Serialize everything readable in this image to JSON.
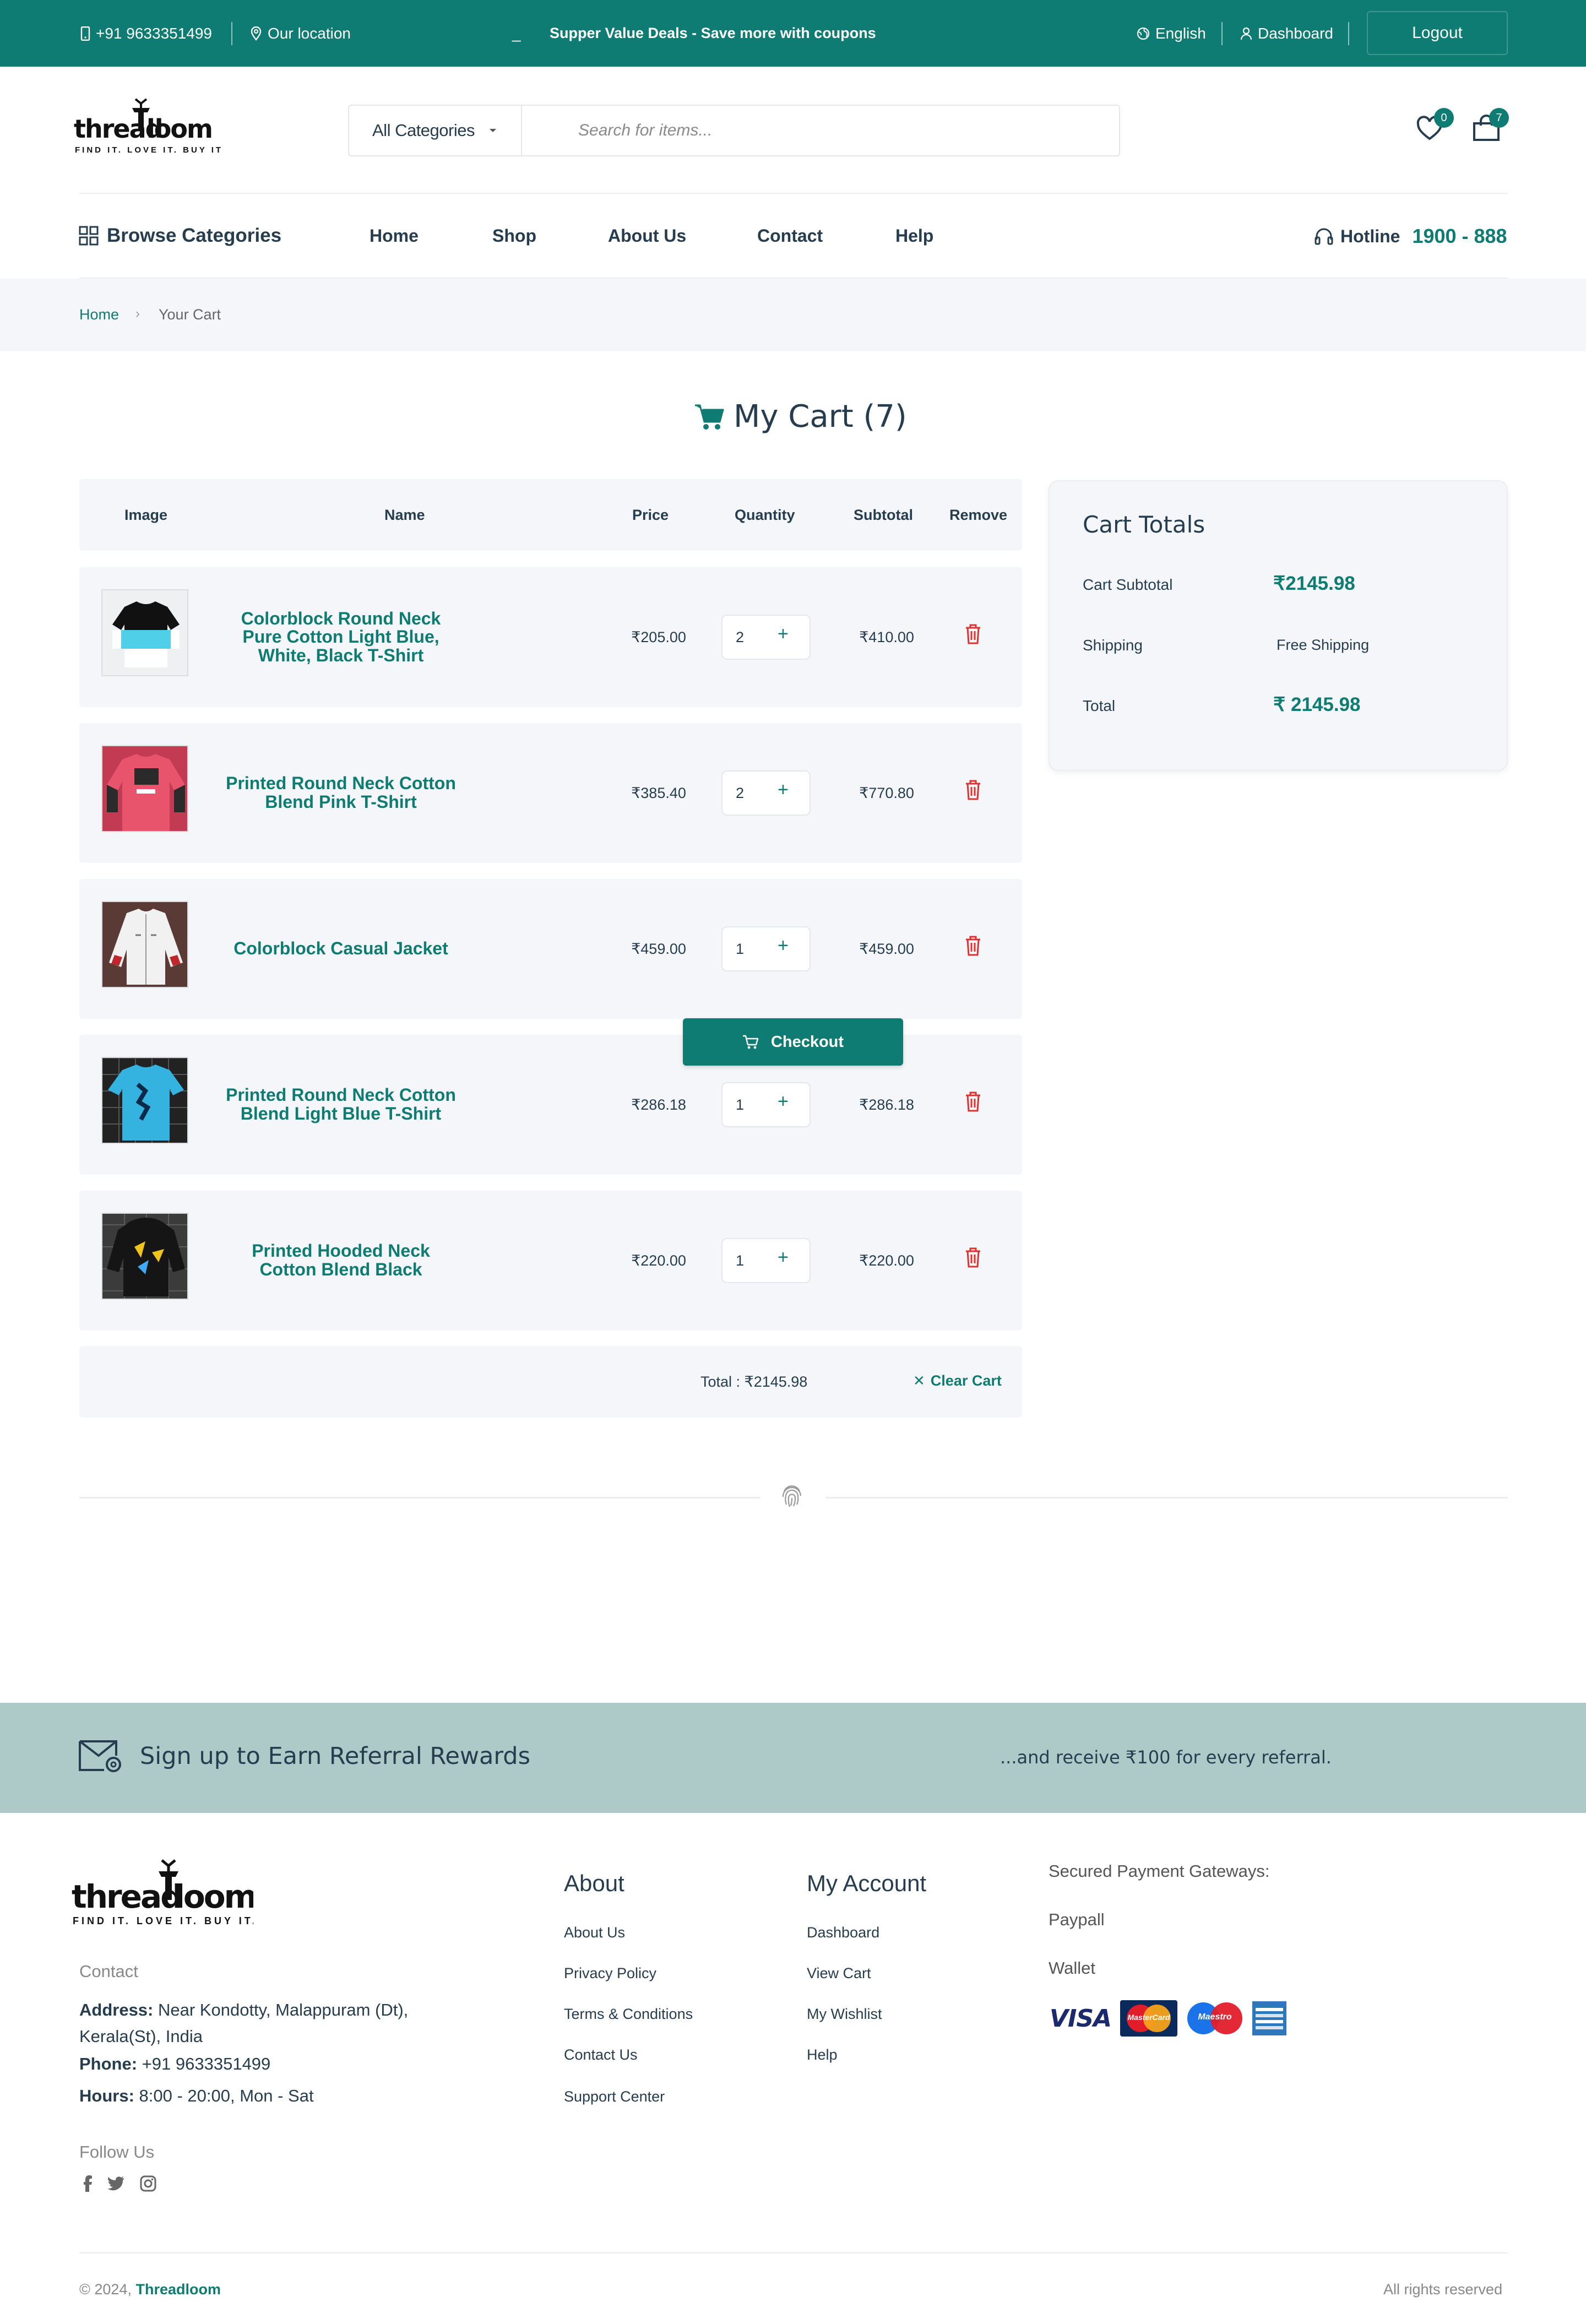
{
  "topbar": {
    "phone": "+91 9633351499",
    "location": "Our location",
    "dash": "_",
    "promo": "Supper Value Deals - Save more with coupons",
    "language": "English",
    "dashboard": "Dashboard",
    "logout": "Logout"
  },
  "brand": {
    "name": "threadloom",
    "tagline": "FIND IT. LOVE IT. BUY IT."
  },
  "search": {
    "category": "All Categories",
    "placeholder": "Search for items..."
  },
  "header": {
    "wishlist_count": "0",
    "cart_count": "7"
  },
  "nav": {
    "browse": "Browse Categories",
    "items": [
      "Home",
      "Shop",
      "About Us",
      "Contact",
      "Help"
    ],
    "hotline_label": "Hotline",
    "hotline_number": "1900 - 888"
  },
  "breadcrumb": {
    "home": "Home",
    "current": "Your Cart"
  },
  "cart": {
    "title": "My Cart (7)",
    "columns": [
      "Image",
      "Name",
      "Price",
      "Quantity",
      "Subtotal",
      "Remove"
    ],
    "items": [
      {
        "name": "Colorblock Round Neck Pure Cotton Light Blue, White, Black T-Shirt",
        "price": "₹205.00",
        "qty": "2",
        "subtotal": "₹410.00",
        "image": "colorblock-tshirt"
      },
      {
        "name": "Printed Round Neck Cotton Blend Pink T-Shirt",
        "price": "₹385.40",
        "qty": "2",
        "subtotal": "₹770.80",
        "image": "pink-tshirt"
      },
      {
        "name": "Colorblock Casual Jacket",
        "price": "₹459.00",
        "qty": "1",
        "subtotal": "₹459.00",
        "image": "jacket"
      },
      {
        "name": "Printed Round Neck Cotton Blend Light Blue T-Shirt",
        "price": "₹286.18",
        "qty": "1",
        "subtotal": "₹286.18",
        "image": "blue-tshirt"
      },
      {
        "name": "Printed Hooded Neck Cotton Blend Black",
        "price": "₹220.00",
        "qty": "1",
        "subtotal": "₹220.00",
        "image": "black-hoodie"
      }
    ],
    "total": "Total : ₹2145.98",
    "clear": "Clear Cart",
    "checkout": "Checkout"
  },
  "totals": {
    "title": "Cart Totals",
    "subtotal_label": "Cart Subtotal",
    "subtotal": "₹2145.98",
    "shipping_label": "Shipping",
    "shipping": "Free Shipping",
    "total_label": "Total",
    "total": "₹ 2145.98"
  },
  "newsletter": {
    "title": "Sign up to Earn Referral Rewards",
    "subtitle": "...and receive ₹100 for every referral."
  },
  "footer": {
    "contact_heading": "Contact",
    "address_label": "Address:",
    "address": "Near Kondotty, Malappuram (Dt), Kerala(St), India",
    "phone_label": "Phone:",
    "phone": "+91 9633351499",
    "hours_label": "Hours:",
    "hours": "8:00 - 20:00, Mon - Sat",
    "follow": "Follow Us",
    "about_heading": "About",
    "about_links": [
      "About Us",
      "Privacy Policy",
      "Terms & Conditions",
      "Contact Us",
      "Support Center"
    ],
    "account_heading": "My Account",
    "account_links": [
      "Dashboard",
      "View Cart",
      "My Wishlist",
      "Help"
    ],
    "payment_heading": "Secured Payment Gateways:",
    "payment_1": "Paypall",
    "payment_2": "Wallet",
    "cards": {
      "visa": "VISA",
      "mastercard": "MasterCard",
      "maestro": "Maestro"
    },
    "copyright": "© 2024,",
    "copyright_brand": "Threadloom",
    "rights": "All rights reserved"
  },
  "colors": {
    "accent": "#0e7c72",
    "text": "#253d4e",
    "danger": "#e03131",
    "bg_soft": "#f4f6fa",
    "newsletter": "#aecac8"
  }
}
